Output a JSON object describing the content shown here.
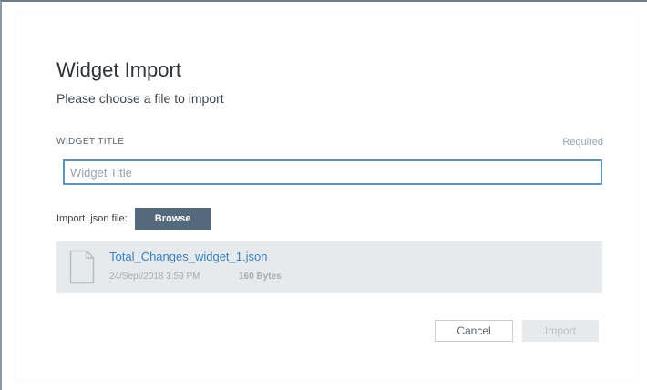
{
  "dialog": {
    "title": "Widget Import",
    "subtitle": "Please choose a file to import"
  },
  "form": {
    "widget_title_label": "WIDGET TITLE",
    "required_text": "Required",
    "widget_title_placeholder": "Widget Title",
    "widget_title_value": "",
    "import_file_label": "Import .json file:",
    "browse_label": "Browse"
  },
  "file": {
    "name": "Total_Changes_widget_1.json",
    "date": "24/Sept/2018 3:59 PM",
    "size": "160 Bytes",
    "icon": "file-icon"
  },
  "actions": {
    "cancel_label": "Cancel",
    "import_label": "Import",
    "import_enabled": false
  },
  "colors": {
    "primary_button": "#54697c",
    "link": "#3c7fbe",
    "input_focus_border": "#5b93bf",
    "file_card_bg": "#e6eaed"
  }
}
